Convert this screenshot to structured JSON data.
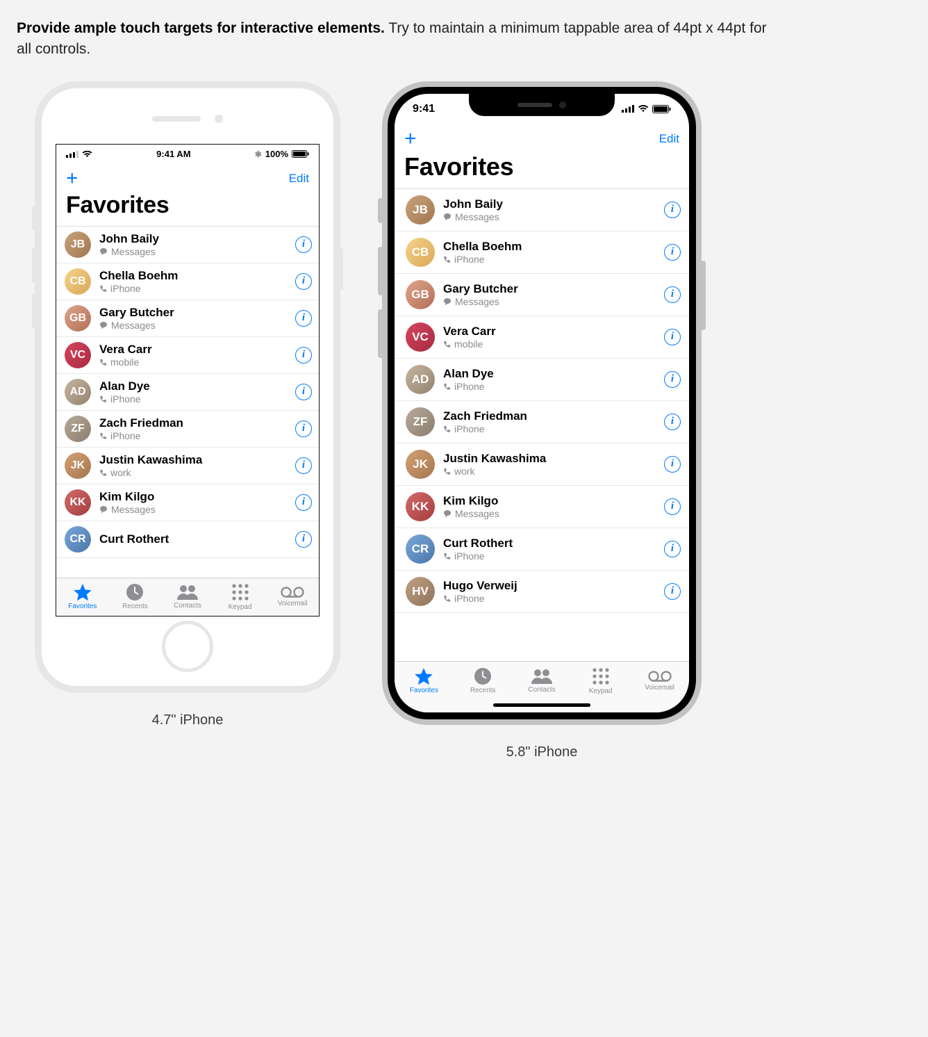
{
  "intro": {
    "bold": "Provide ample touch targets for interactive elements.",
    "rest": " Try to maintain a minimum tappable area of 44pt x 44pt for all controls."
  },
  "captions": {
    "a": "4.7\" iPhone",
    "b": "5.8\" iPhone"
  },
  "phoneA": {
    "status": {
      "time": "9:41 AM",
      "battery": "100%"
    },
    "nav": {
      "add": "+",
      "edit": "Edit",
      "title": "Favorites"
    },
    "contacts": [
      {
        "name": "John Baily",
        "sub": "Messages",
        "icon": "bubble"
      },
      {
        "name": "Chella Boehm",
        "sub": "iPhone",
        "icon": "phone"
      },
      {
        "name": "Gary Butcher",
        "sub": "Messages",
        "icon": "bubble"
      },
      {
        "name": "Vera Carr",
        "sub": "mobile",
        "icon": "phone"
      },
      {
        "name": "Alan Dye",
        "sub": "iPhone",
        "icon": "phone"
      },
      {
        "name": "Zach Friedman",
        "sub": "iPhone",
        "icon": "phone"
      },
      {
        "name": "Justin Kawashima",
        "sub": "work",
        "icon": "phone"
      },
      {
        "name": "Kim Kilgo",
        "sub": "Messages",
        "icon": "bubble"
      },
      {
        "name": "Curt Rothert",
        "sub": "",
        "icon": ""
      }
    ],
    "tabs": [
      {
        "label": "Favorites",
        "icon": "star",
        "active": true
      },
      {
        "label": "Recents",
        "icon": "clock",
        "active": false
      },
      {
        "label": "Contacts",
        "icon": "contacts",
        "active": false
      },
      {
        "label": "Keypad",
        "icon": "keypad",
        "active": false
      },
      {
        "label": "Voicemail",
        "icon": "voicemail",
        "active": false
      }
    ]
  },
  "phoneB": {
    "status": {
      "time": "9:41"
    },
    "nav": {
      "add": "+",
      "edit": "Edit",
      "title": "Favorites"
    },
    "contacts": [
      {
        "name": "John Baily",
        "sub": "Messages",
        "icon": "bubble"
      },
      {
        "name": "Chella Boehm",
        "sub": "iPhone",
        "icon": "phone"
      },
      {
        "name": "Gary Butcher",
        "sub": "Messages",
        "icon": "bubble"
      },
      {
        "name": "Vera Carr",
        "sub": "mobile",
        "icon": "phone"
      },
      {
        "name": "Alan Dye",
        "sub": "iPhone",
        "icon": "phone"
      },
      {
        "name": "Zach Friedman",
        "sub": "iPhone",
        "icon": "phone"
      },
      {
        "name": "Justin Kawashima",
        "sub": "work",
        "icon": "phone"
      },
      {
        "name": "Kim Kilgo",
        "sub": "Messages",
        "icon": "bubble"
      },
      {
        "name": "Curt Rothert",
        "sub": "iPhone",
        "icon": "phone"
      },
      {
        "name": "Hugo Verweij",
        "sub": "iPhone",
        "icon": "phone"
      }
    ],
    "tabs": [
      {
        "label": "Favorites",
        "icon": "star",
        "active": true
      },
      {
        "label": "Recents",
        "icon": "clock",
        "active": false
      },
      {
        "label": "Contacts",
        "icon": "contacts",
        "active": false
      },
      {
        "label": "Keypad",
        "icon": "keypad",
        "active": false
      },
      {
        "label": "Voicemail",
        "icon": "voicemail",
        "active": false
      }
    ]
  }
}
